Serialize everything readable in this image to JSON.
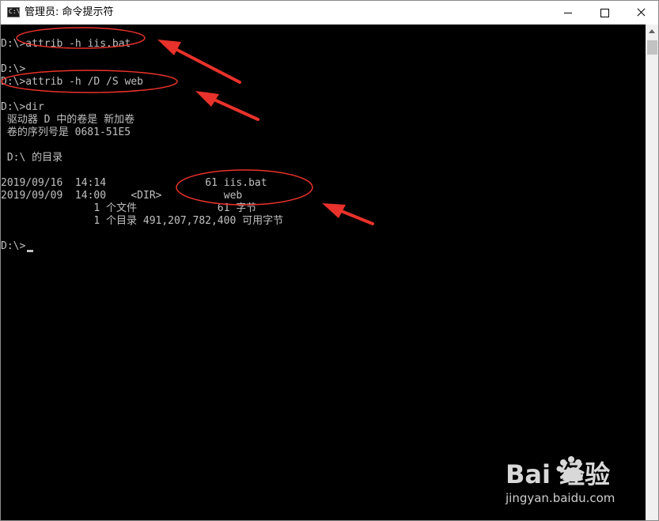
{
  "window": {
    "title": "管理员: 命令提示符",
    "app_icon_text": "C:\\."
  },
  "console": {
    "lines": [
      "D:\\>attrib -h iis.bat",
      "",
      "D:\\>",
      "D:\\>attrib -h /D /S web",
      "",
      "D:\\>dir",
      " 驱动器 D 中的卷是 新加卷",
      " 卷的序列号是 0681-51E5",
      "",
      " D:\\ 的目录",
      "",
      "2019/09/16  14:14                61 iis.bat",
      "2019/09/09  14:00    <DIR>          web",
      "               1 个文件             61 字节",
      "               1 个目录 491,207,782,400 可用字节",
      "",
      "D:\\>"
    ]
  },
  "annotations": {
    "color": "#e8322b"
  },
  "watermark": {
    "logo_text": "Bai 经验",
    "url": "jingyan.baidu.com"
  }
}
